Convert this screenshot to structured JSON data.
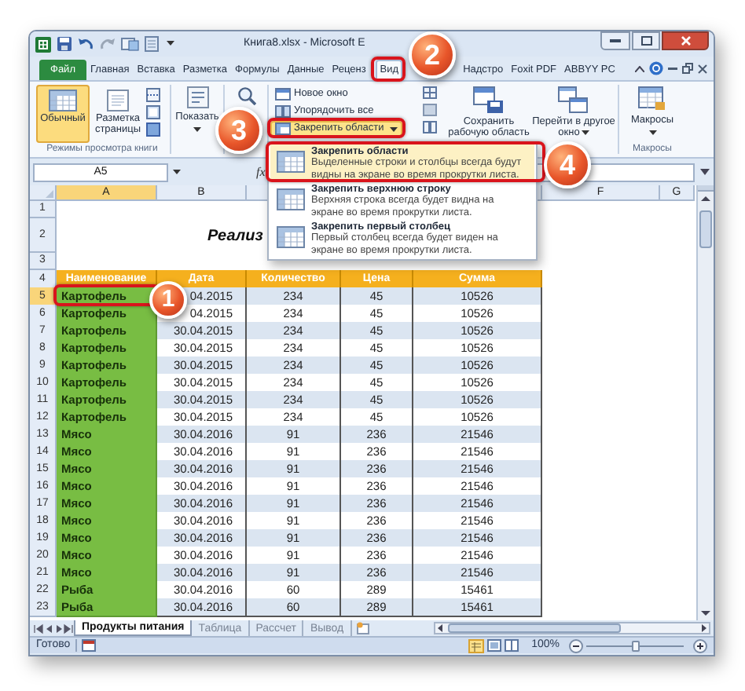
{
  "window": {
    "title": "Книга8.xlsx - Microsoft E"
  },
  "ribbon_tabs": [
    {
      "label": "Файл",
      "kind": "file",
      "selected": false
    },
    {
      "label": "Главная",
      "kind": "tab",
      "selected": false
    },
    {
      "label": "Вставка",
      "kind": "tab",
      "selected": false
    },
    {
      "label": "Разметка",
      "kind": "tab",
      "selected": false
    },
    {
      "label": "Формулы",
      "kind": "tab",
      "selected": false
    },
    {
      "label": "Данные",
      "kind": "tab",
      "selected": false
    },
    {
      "label": "Реценз",
      "kind": "tab",
      "selected": false
    },
    {
      "label": "Вид",
      "kind": "tab",
      "selected": true
    },
    {
      "label": "Надстро",
      "kind": "tab",
      "selected": false
    },
    {
      "label": "Foxit PDF",
      "kind": "tab",
      "selected": false
    },
    {
      "label": "ABBYY PC",
      "kind": "tab",
      "selected": false
    }
  ],
  "ribbon": {
    "view_modes": [
      {
        "label": "Обычный",
        "selected": true
      },
      {
        "label": "Разметка страницы",
        "selected": false
      }
    ],
    "view_group_label": "Режимы просмотра книги",
    "show_button": "Показать",
    "window_commands": [
      {
        "label": "Новое окно",
        "selected": false
      },
      {
        "label": "Упорядочить все",
        "selected": false
      },
      {
        "label": "Закрепить области",
        "selected": true
      }
    ],
    "save_workspace": "Сохранить рабочую область",
    "switch_windows": "Перейти в другое окно",
    "macros_button": "Макросы",
    "macros_group_label": "Макросы"
  },
  "formula_bar": {
    "name_box": "A5",
    "function_button": "fx"
  },
  "freeze_menu": [
    {
      "title": "Закрепить области",
      "description": "Выделенные строки и столбцы всегда будут видны на экране во время прокрутки листа.",
      "selected": true
    },
    {
      "title": "Закрепить верхнюю строку",
      "description": "Верхняя строка всегда будет видна на экране во время прокрутки листа.",
      "selected": false
    },
    {
      "title": "Закрепить первый столбец",
      "description": "Первый столбец всегда будет виден на экране во время прокрутки листа.",
      "selected": false
    }
  ],
  "columns": [
    {
      "label": "A",
      "selected": true
    },
    {
      "label": "B",
      "selected": false
    },
    {
      "label": "F",
      "selected": false
    },
    {
      "label": "G",
      "selected": false
    }
  ],
  "rows": [
    {
      "number": "1",
      "kind": "blank",
      "selected": false
    },
    {
      "number": "2",
      "kind": "title",
      "selected": false,
      "title": "Реализ"
    },
    {
      "number": "3",
      "kind": "blank",
      "selected": false
    },
    {
      "number": "4",
      "kind": "header",
      "selected": false,
      "cells": [
        "Наименование",
        "Дата",
        "Количество",
        "Цена",
        "Сумма"
      ]
    },
    {
      "number": "5",
      "kind": "data",
      "selected": true,
      "cells": [
        "Картофель",
        "04.2015",
        "234",
        "45",
        "10526"
      ]
    },
    {
      "number": "6",
      "kind": "data",
      "selected": false,
      "cells": [
        "Картофель",
        "04.2015",
        "234",
        "45",
        "10526"
      ]
    },
    {
      "number": "7",
      "kind": "data",
      "selected": false,
      "cells": [
        "Картофель",
        "30.04.2015",
        "234",
        "45",
        "10526"
      ]
    },
    {
      "number": "8",
      "kind": "data",
      "selected": false,
      "cells": [
        "Картофель",
        "30.04.2015",
        "234",
        "45",
        "10526"
      ]
    },
    {
      "number": "9",
      "kind": "data",
      "selected": false,
      "cells": [
        "Картофель",
        "30.04.2015",
        "234",
        "45",
        "10526"
      ]
    },
    {
      "number": "10",
      "kind": "data",
      "selected": false,
      "cells": [
        "Картофель",
        "30.04.2015",
        "234",
        "45",
        "10526"
      ]
    },
    {
      "number": "11",
      "kind": "data",
      "selected": false,
      "cells": [
        "Картофель",
        "30.04.2015",
        "234",
        "45",
        "10526"
      ]
    },
    {
      "number": "12",
      "kind": "data",
      "selected": false,
      "cells": [
        "Картофель",
        "30.04.2015",
        "234",
        "45",
        "10526"
      ]
    },
    {
      "number": "13",
      "kind": "data",
      "selected": false,
      "cells": [
        "Мясо",
        "30.04.2016",
        "91",
        "236",
        "21546"
      ]
    },
    {
      "number": "14",
      "kind": "data",
      "selected": false,
      "cells": [
        "Мясо",
        "30.04.2016",
        "91",
        "236",
        "21546"
      ]
    },
    {
      "number": "15",
      "kind": "data",
      "selected": false,
      "cells": [
        "Мясо",
        "30.04.2016",
        "91",
        "236",
        "21546"
      ]
    },
    {
      "number": "16",
      "kind": "data",
      "selected": false,
      "cells": [
        "Мясо",
        "30.04.2016",
        "91",
        "236",
        "21546"
      ]
    },
    {
      "number": "17",
      "kind": "data",
      "selected": false,
      "cells": [
        "Мясо",
        "30.04.2016",
        "91",
        "236",
        "21546"
      ]
    },
    {
      "number": "18",
      "kind": "data",
      "selected": false,
      "cells": [
        "Мясо",
        "30.04.2016",
        "91",
        "236",
        "21546"
      ]
    },
    {
      "number": "19",
      "kind": "data",
      "selected": false,
      "cells": [
        "Мясо",
        "30.04.2016",
        "91",
        "236",
        "21546"
      ]
    },
    {
      "number": "20",
      "kind": "data",
      "selected": false,
      "cells": [
        "Мясо",
        "30.04.2016",
        "91",
        "236",
        "21546"
      ]
    },
    {
      "number": "21",
      "kind": "data",
      "selected": false,
      "cells": [
        "Мясо",
        "30.04.2016",
        "91",
        "236",
        "21546"
      ]
    },
    {
      "number": "22",
      "kind": "data",
      "selected": false,
      "cells": [
        "Рыба",
        "30.04.2016",
        "60",
        "289",
        "15461"
      ]
    },
    {
      "number": "23",
      "kind": "data",
      "selected": false,
      "cells": [
        "Рыба",
        "30.04.2016",
        "60",
        "289",
        "15461"
      ]
    }
  ],
  "sheet_tabs": [
    {
      "label": "Продукты питания",
      "selected": true
    },
    {
      "label": "Таблица",
      "selected": false
    },
    {
      "label": "Рассчет",
      "selected": false
    },
    {
      "label": "Вывод",
      "selected": false
    }
  ],
  "status_bar": {
    "status": "Готово",
    "zoom": "100%",
    "zoom_slider": {
      "level": 0.5
    }
  },
  "callouts": [
    {
      "number": "1"
    },
    {
      "number": "2"
    },
    {
      "number": "3"
    },
    {
      "number": "4"
    }
  ]
}
